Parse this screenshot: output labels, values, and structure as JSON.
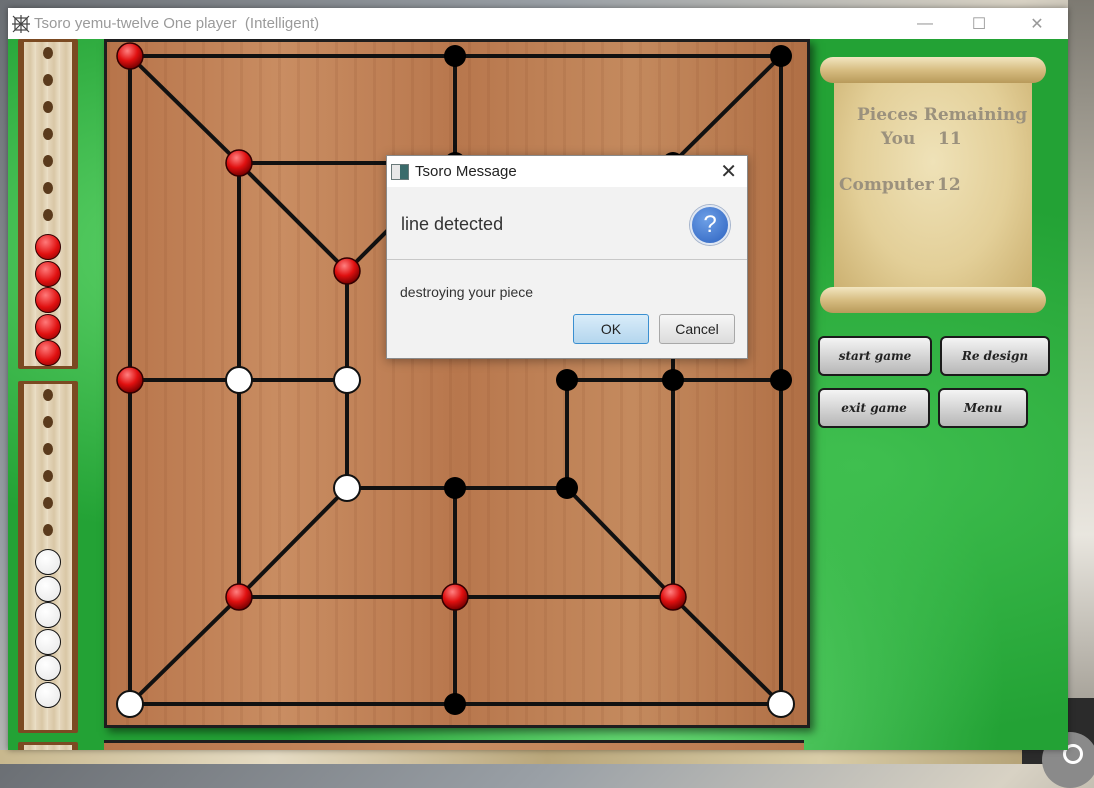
{
  "window": {
    "title": "Tsoro yemu-twelve One player  (Intelligent)",
    "controls": {
      "minimize": "—",
      "maximize": "☐",
      "close": "✕"
    }
  },
  "score_panel": {
    "heading": "Pieces Remaining",
    "you_label": "You",
    "you_count": "11",
    "computer_label": "Computer",
    "computer_count": "12"
  },
  "buttons": {
    "start_game": "start game",
    "re_design": "Re design",
    "exit_game": "exit game",
    "menu": "Menu"
  },
  "dialog": {
    "title": "Tsoro Message",
    "close": "✕",
    "header": "line detected",
    "icon": "question-icon",
    "icon_glyph": "?",
    "message": "destroying your piece",
    "ok": "OK",
    "cancel": "Cancel"
  },
  "racks": {
    "computer": {
      "empty_holes": 7,
      "pieces": 5,
      "piece_color": "#e01010"
    },
    "player": {
      "empty_holes": 6,
      "pieces": 6,
      "piece_color": "#ffffff"
    }
  },
  "board": {
    "nodes": {
      "tl": "red",
      "tm": "empty",
      "tr": "empty",
      "i1": "red",
      "i1t": "empty",
      "i1tr": "empty",
      "i2": "red",
      "ml": "red",
      "ml1": "white",
      "ml2": "white",
      "mr2": "empty",
      "mr1": "empty",
      "mr": "empty",
      "i2b": "white",
      "i2bm": "empty",
      "i2br": "empty",
      "i1bl": "red",
      "i1bm": "red",
      "i1br": "red",
      "bl": "white",
      "bm": "empty",
      "br": "white"
    }
  },
  "colors": {
    "red_piece": "#e01010",
    "white_piece": "#ffffff",
    "empty_node": "#000000",
    "felt": "#23a235",
    "board_wood": "#c08258"
  }
}
